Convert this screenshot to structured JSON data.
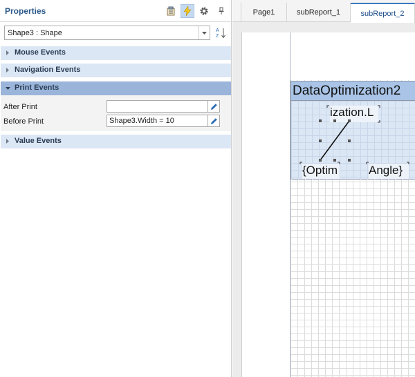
{
  "properties": {
    "title": "Properties",
    "selected_object": "Shape3 : Shape",
    "categories": {
      "mouse": "Mouse Events",
      "navigation": "Navigation Events",
      "print": "Print Events",
      "value": "Value Events"
    },
    "print_events": {
      "after_print_label": "After Print",
      "after_print_value": "",
      "before_print_label": "Before Print",
      "before_print_value": "Shape3.Width = 10"
    },
    "icons": {
      "categorized": "categorized-icon",
      "events": "lightning-icon",
      "settings": "gear-icon",
      "pin": "pin-icon",
      "sort": "sort-az-icon",
      "dropdown": "chevron-down-icon",
      "edit": "pencil-icon"
    },
    "colors": {
      "title": "#2d5a8a",
      "category_bg": "#dce7f5",
      "category_active_bg": "#9bb5da",
      "edit_icon": "#2f6db5"
    }
  },
  "designer": {
    "tabs": [
      {
        "label": "Page1"
      },
      {
        "label": "subReport_1"
      },
      {
        "label": "subReport_2",
        "active": true
      }
    ],
    "band_title": "DataOptimization2",
    "fields": {
      "top": "ization.L",
      "bottom_left": "{Optim",
      "bottom_right": "Angle}"
    },
    "colors": {
      "band_header": "#a9c4e6",
      "band_body": "#dce7f5",
      "active_tab_accent": "#3d78c2"
    }
  }
}
